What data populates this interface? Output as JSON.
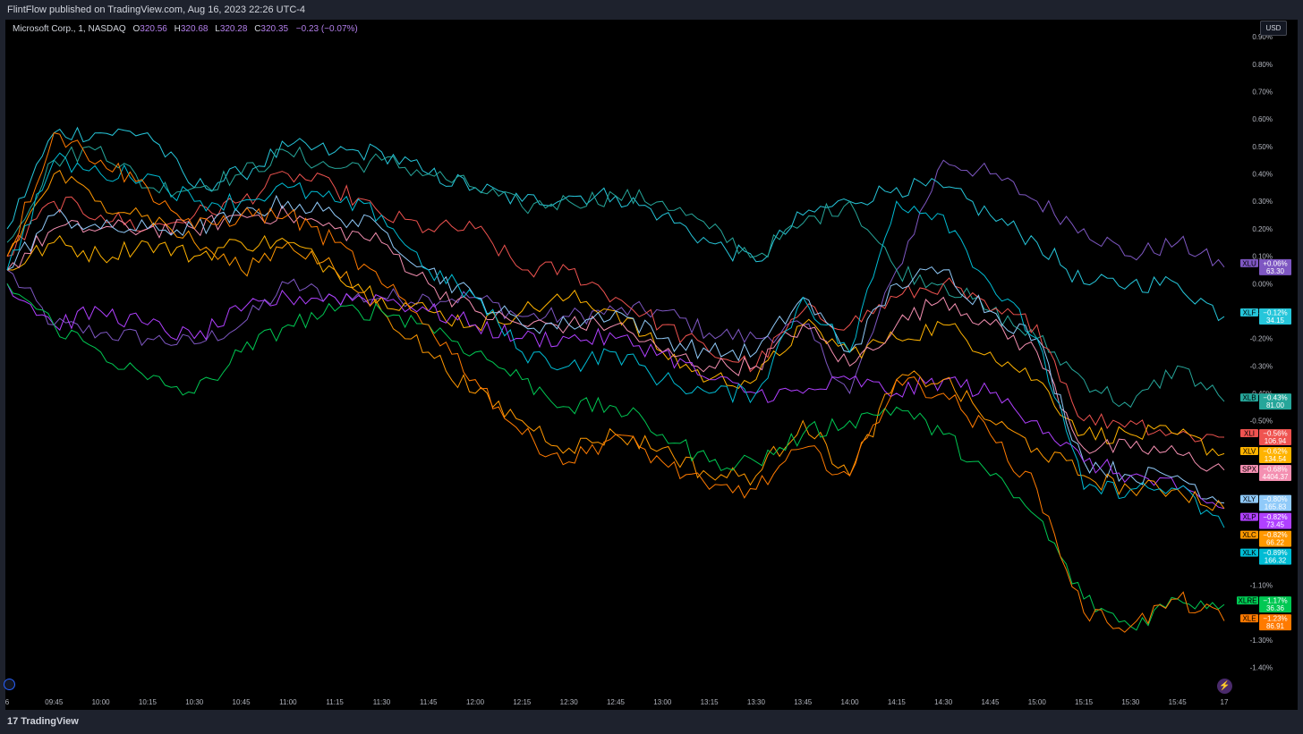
{
  "header": {
    "published_by": "FlintFlow published on TradingView.com, Aug 16, 2023 22:26 UTC-4"
  },
  "legend": {
    "symbol": "Microsoft Corp., 1, NASDAQ",
    "open_label": "O",
    "open_value": "320.56",
    "high_label": "H",
    "high_value": "320.68",
    "low_label": "L",
    "low_value": "320.28",
    "close_label": "C",
    "close_value": "320.35",
    "change": "−0.23 (−0.07%)"
  },
  "currency_button": "USD",
  "footer": {
    "brand": "TradingView",
    "logo_mark": "17"
  },
  "icons": {
    "goto_realtime": "goto-realtime-icon",
    "bolt": "lightning-icon",
    "logo": "tradingview-logo-icon"
  },
  "chart_data": {
    "type": "line",
    "title": "",
    "xlabel": "",
    "ylabel": "",
    "y_unit": "%",
    "ylim": [
      -1.45,
      0.93
    ],
    "grid": false,
    "x_ticks": [
      "6",
      "09:45",
      "10:00",
      "10:15",
      "10:30",
      "10:45",
      "11:00",
      "11:15",
      "11:30",
      "11:45",
      "12:00",
      "12:15",
      "12:30",
      "12:45",
      "13:00",
      "13:15",
      "13:30",
      "13:45",
      "14:00",
      "14:15",
      "14:30",
      "14:45",
      "15:00",
      "15:15",
      "15:30",
      "15:45",
      "17"
    ],
    "y_ticks": [
      "0.90%",
      "0.80%",
      "0.70%",
      "0.60%",
      "0.50%",
      "0.40%",
      "0.30%",
      "0.20%",
      "0.10%",
      "0.00%",
      "-0.10%",
      "-0.20%",
      "-0.30%",
      "-0.40%",
      "-0.50%",
      "-1.10%",
      "-1.30%",
      "-1.40%"
    ],
    "x": [
      "09:30",
      "09:45",
      "10:00",
      "10:15",
      "10:30",
      "10:45",
      "11:00",
      "11:15",
      "11:30",
      "11:45",
      "12:00",
      "12:15",
      "12:30",
      "12:45",
      "13:00",
      "13:15",
      "13:30",
      "13:45",
      "14:00",
      "14:15",
      "14:30",
      "14:45",
      "15:00",
      "15:15",
      "15:30",
      "15:45",
      "16:00"
    ],
    "series": [
      {
        "name": "XLU",
        "color": "#7e57c2",
        "last_label": "+0.06%",
        "price_label": "63.30",
        "values": [
          0.05,
          -0.15,
          -0.18,
          -0.2,
          -0.22,
          -0.15,
          0.0,
          -0.05,
          -0.05,
          -0.05,
          -0.05,
          -0.12,
          -0.12,
          -0.1,
          -0.1,
          -0.18,
          -0.2,
          -0.15,
          -0.4,
          0.05,
          0.45,
          0.4,
          0.3,
          0.2,
          0.1,
          0.15,
          0.06
        ]
      },
      {
        "name": "XLF",
        "color": "#26c6da",
        "last_label": "−0.12%",
        "price_label": "34.15",
        "values": [
          0.2,
          0.55,
          0.55,
          0.55,
          0.35,
          0.4,
          0.5,
          0.48,
          0.48,
          0.4,
          0.35,
          0.3,
          0.32,
          0.32,
          0.25,
          0.15,
          0.08,
          0.25,
          0.3,
          0.35,
          0.35,
          0.25,
          0.15,
          0.0,
          0.0,
          0.0,
          -0.12
        ]
      },
      {
        "name": "XLB",
        "color": "#26a69a",
        "last_label": "−0.43%",
        "price_label": "81.00",
        "values": [
          0.15,
          0.45,
          0.5,
          0.35,
          0.35,
          0.4,
          0.48,
          0.42,
          0.45,
          0.4,
          0.35,
          0.28,
          0.3,
          0.32,
          0.3,
          0.2,
          0.1,
          0.22,
          0.3,
          0.05,
          0.0,
          -0.1,
          -0.2,
          -0.35,
          -0.45,
          -0.3,
          -0.43
        ]
      },
      {
        "name": "XLI",
        "color": "#ef5350",
        "last_label": "−0.56%",
        "price_label": "106.94",
        "values": [
          0.1,
          0.3,
          0.25,
          0.2,
          0.25,
          0.3,
          0.4,
          0.35,
          0.25,
          0.2,
          0.2,
          0.05,
          0.05,
          -0.05,
          -0.15,
          -0.25,
          -0.3,
          -0.1,
          -0.15,
          -0.05,
          0.0,
          -0.1,
          -0.15,
          -0.5,
          -0.5,
          -0.55,
          -0.56
        ]
      },
      {
        "name": "XLV",
        "color": "#ffb300",
        "last_label": "−0.62%",
        "price_label": "134.54",
        "values": [
          0.05,
          0.15,
          0.1,
          0.15,
          0.1,
          0.15,
          0.15,
          0.05,
          -0.05,
          -0.1,
          -0.15,
          -0.1,
          -0.05,
          -0.1,
          -0.25,
          -0.35,
          -0.35,
          -0.15,
          -0.25,
          -0.2,
          -0.15,
          -0.25,
          -0.35,
          -0.55,
          -0.55,
          -0.55,
          -0.62
        ]
      },
      {
        "name": "SPX",
        "color": "#f48fb1",
        "last_label": "−0.68%",
        "price_label": "4404.37",
        "values": [
          0.05,
          0.2,
          0.2,
          0.2,
          0.2,
          0.25,
          0.25,
          0.2,
          0.15,
          0.0,
          -0.1,
          -0.15,
          -0.15,
          -0.15,
          -0.25,
          -0.3,
          -0.3,
          -0.15,
          -0.3,
          -0.15,
          -0.05,
          -0.15,
          -0.25,
          -0.6,
          -0.6,
          -0.62,
          -0.68
        ]
      },
      {
        "name": "XLY",
        "color": "#90caf9",
        "last_label": "−0.80%",
        "price_label": "165.83",
        "values": [
          0.05,
          0.25,
          0.2,
          0.2,
          0.2,
          0.25,
          0.3,
          0.25,
          0.2,
          0.05,
          -0.05,
          -0.15,
          -0.15,
          -0.1,
          -0.2,
          -0.25,
          -0.25,
          -0.05,
          -0.25,
          0.0,
          0.05,
          -0.1,
          -0.2,
          -0.65,
          -0.7,
          -0.7,
          -0.8
        ]
      },
      {
        "name": "XLP",
        "color": "#b040ff",
        "last_label": "−0.82%",
        "price_label": "73.45",
        "values": [
          0.0,
          -0.15,
          -0.1,
          -0.15,
          -0.2,
          -0.1,
          -0.05,
          -0.05,
          -0.05,
          -0.1,
          -0.15,
          -0.2,
          -0.2,
          -0.2,
          -0.25,
          -0.35,
          -0.4,
          -0.4,
          -0.35,
          -0.4,
          -0.35,
          -0.4,
          -0.5,
          -0.65,
          -0.7,
          -0.75,
          -0.82
        ]
      },
      {
        "name": "XLC",
        "color": "#ff9800",
        "last_label": "−0.82%",
        "price_label": "66.22",
        "values": [
          0.1,
          0.4,
          0.3,
          0.25,
          0.15,
          0.05,
          0.15,
          0.05,
          -0.1,
          -0.25,
          -0.4,
          -0.5,
          -0.6,
          -0.55,
          -0.6,
          -0.7,
          -0.7,
          -0.5,
          -0.7,
          -0.35,
          -0.35,
          -0.5,
          -0.6,
          -0.7,
          -0.75,
          -0.75,
          -0.82
        ]
      },
      {
        "name": "XLK",
        "color": "#00bcd4",
        "last_label": "−0.89%",
        "price_label": "166.32",
        "values": [
          0.05,
          0.45,
          0.4,
          0.4,
          0.3,
          0.3,
          0.35,
          0.3,
          0.25,
          0.05,
          -0.05,
          -0.25,
          -0.3,
          -0.25,
          -0.35,
          -0.4,
          -0.4,
          -0.05,
          -0.25,
          0.3,
          0.25,
          0.0,
          -0.2,
          -0.75,
          -0.75,
          -0.75,
          -0.89
        ]
      },
      {
        "name": "XLRE",
        "color": "#00c853",
        "last_label": "−1.17%",
        "price_label": "36.36",
        "values": [
          0.0,
          -0.15,
          -0.25,
          -0.35,
          -0.4,
          -0.25,
          -0.15,
          -0.1,
          -0.1,
          -0.15,
          -0.25,
          -0.35,
          -0.45,
          -0.45,
          -0.55,
          -0.65,
          -0.65,
          -0.55,
          -0.5,
          -0.45,
          -0.55,
          -0.7,
          -0.85,
          -1.15,
          -1.25,
          -1.15,
          -1.17
        ]
      },
      {
        "name": "XLE",
        "color": "#ff7a00",
        "last_label": "−1.23%",
        "price_label": "86.91",
        "values": [
          0.1,
          0.55,
          0.45,
          0.35,
          0.2,
          0.25,
          0.25,
          0.15,
          0.0,
          -0.15,
          -0.35,
          -0.55,
          -0.65,
          -0.55,
          -0.65,
          -0.75,
          -0.75,
          -0.6,
          -0.7,
          -0.35,
          -0.4,
          -0.55,
          -0.75,
          -1.2,
          -1.25,
          -1.15,
          -1.23
        ]
      }
    ]
  }
}
